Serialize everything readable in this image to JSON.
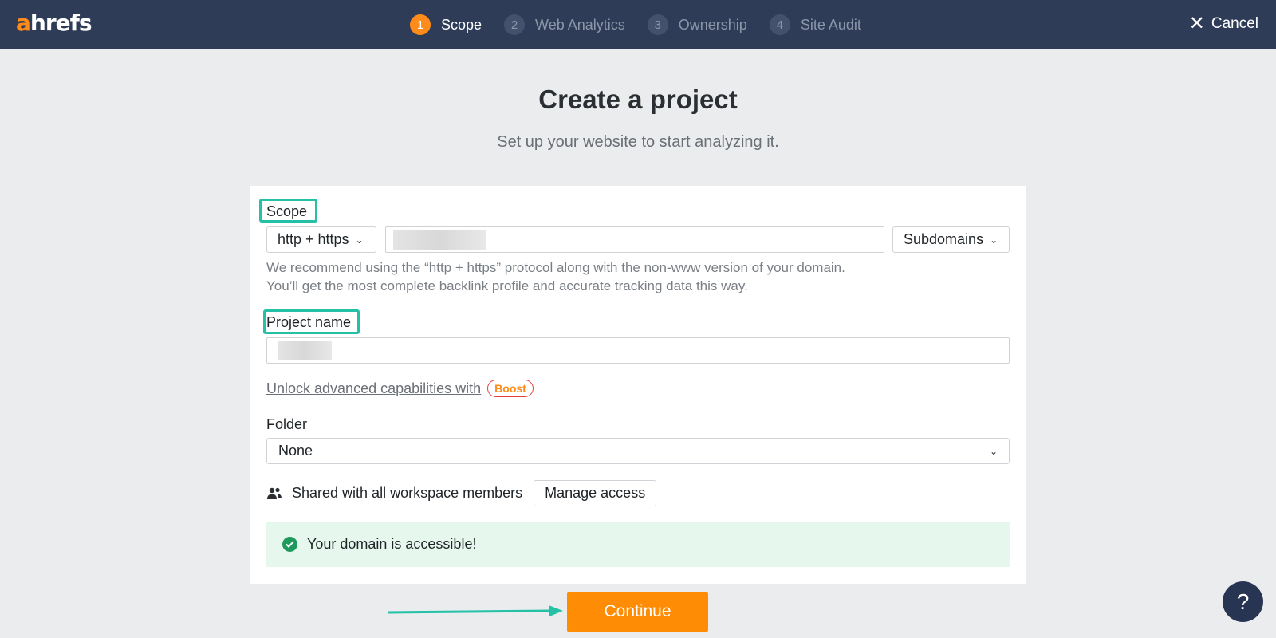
{
  "brand": {
    "logo_accent": "a",
    "logo_rest": "hrefs",
    "accent_color": "#ff8c1a"
  },
  "header": {
    "steps": [
      {
        "num": "1",
        "label": "Scope",
        "active": true
      },
      {
        "num": "2",
        "label": "Web Analytics",
        "active": false
      },
      {
        "num": "3",
        "label": "Ownership",
        "active": false
      },
      {
        "num": "4",
        "label": "Site Audit",
        "active": false
      }
    ],
    "cancel_label": "Cancel",
    "cancel_icon": "close-icon"
  },
  "page": {
    "title": "Create a project",
    "subtitle": "Set up your website to start analyzing it."
  },
  "form": {
    "scope_label": "Scope",
    "protocol_value": "http + https",
    "domain_value": "",
    "mode_value": "Subdomains",
    "hint": "We recommend using the “http + https” protocol along with the non-www version of your domain. You’ll get the most complete backlink profile and accurate tracking data this way.",
    "project_name_label": "Project name",
    "project_name_value": "",
    "unlock_text": "Unlock advanced capabilities with",
    "boost_label": "Boost",
    "folder_label": "Folder",
    "folder_value": "None",
    "shared_text": "Shared with all workspace members",
    "manage_access_label": "Manage access",
    "success_text": "Your domain is accessible!",
    "success_color": "#1f9a5c"
  },
  "actions": {
    "continue_label": "Continue",
    "continue_color": "#ff8c05"
  },
  "help": {
    "label": "?"
  }
}
